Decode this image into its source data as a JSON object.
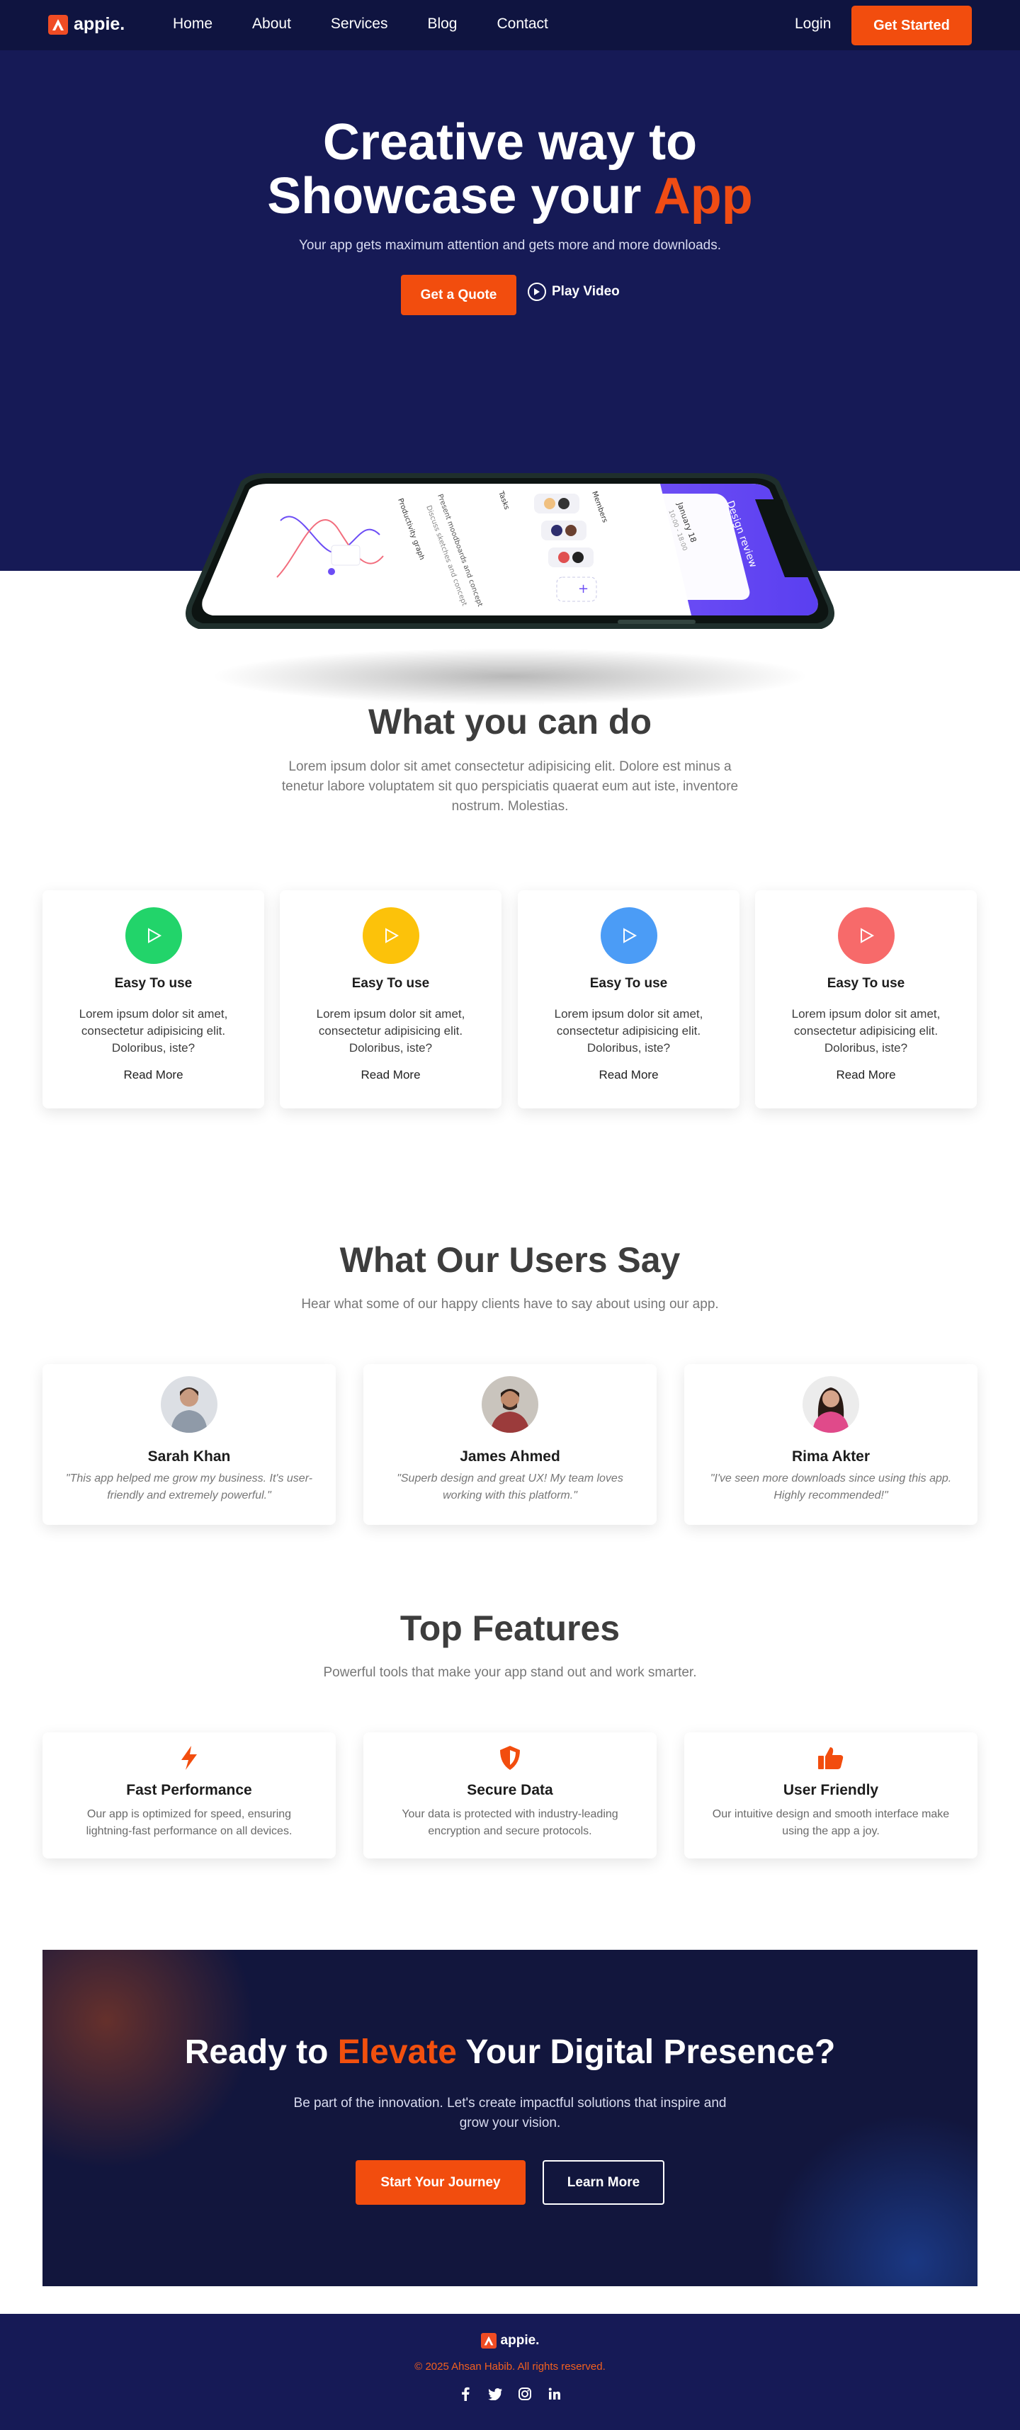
{
  "nav": {
    "brand": "appie.",
    "links": [
      "Home",
      "About",
      "Services",
      "Blog",
      "Contact"
    ],
    "login": "Login",
    "cta": "Get Started"
  },
  "hero": {
    "title_line1": "Creative way to",
    "title_line2_main": "Showcase your",
    "title_line2_accent": "App",
    "subtitle": "Your app gets maximum attention and gets more and more downloads.",
    "quote_button": "Get a Quote",
    "play_button": "Play Video"
  },
  "phone_screen": {
    "header": "Design review",
    "date": "January 18",
    "time": "10:00 - 18:00",
    "members_label": "Members",
    "tasks_label": "Tasks",
    "task1": "Present moodboards and concept",
    "task2": "Discuss sketches and concept",
    "graph_label": "Productivity graph"
  },
  "what": {
    "title": "What you can do",
    "subtitle": "Lorem ipsum dolor sit amet consectetur adipisicing elit. Dolore est minus a tenetur labore voluptatem sit quo perspiciatis quaerat eum aut iste, inventore nostrum. Molestias.",
    "cards": [
      {
        "title": "Easy To use",
        "text": "Lorem ipsum dolor sit amet, consectetur adipisicing elit. Doloribus, iste?",
        "link": "Read More",
        "color": "#22d46a"
      },
      {
        "title": "Easy To use",
        "text": "Lorem ipsum dolor sit amet, consectetur adipisicing elit. Doloribus, iste?",
        "link": "Read More",
        "color": "#fcc20a"
      },
      {
        "title": "Easy To use",
        "text": "Lorem ipsum dolor sit amet, consectetur adipisicing elit. Doloribus, iste?",
        "link": "Read More",
        "color": "#4b9cf6"
      },
      {
        "title": "Easy To use",
        "text": "Lorem ipsum dolor sit amet, consectetur adipisicing elit. Doloribus, iste?",
        "link": "Read More",
        "color": "#f76a6a"
      }
    ]
  },
  "users": {
    "title": "What Our Users Say",
    "subtitle": "Hear what some of our happy clients have to say about using our app.",
    "items": [
      {
        "name": "Sarah Khan",
        "quote": "\"This app helped me grow my business. It's user-friendly and extremely powerful.\""
      },
      {
        "name": "James Ahmed",
        "quote": "\"Superb design and great UX! My team loves working with this platform.\""
      },
      {
        "name": "Rima Akter",
        "quote": "\"I've seen more downloads since using this app. Highly recommended!\""
      }
    ]
  },
  "features": {
    "title": "Top Features",
    "subtitle": "Powerful tools that make your app stand out and work smarter.",
    "items": [
      {
        "icon": "bolt-icon",
        "title": "Fast Performance",
        "text": "Our app is optimized for speed, ensuring lightning-fast performance on all devices."
      },
      {
        "icon": "shield-icon",
        "title": "Secure Data",
        "text": "Your data is protected with industry-leading encryption and secure protocols."
      },
      {
        "icon": "thumbs-up-icon",
        "title": "User Friendly",
        "text": "Our intuitive design and smooth interface make using the app a joy."
      }
    ]
  },
  "cta": {
    "title_before": "Ready to",
    "title_accent": "Elevate",
    "title_after": "Your Digital Presence?",
    "subtitle": "Be part of the innovation. Let's create impactful solutions that inspire and grow your vision.",
    "primary": "Start Your Journey",
    "secondary": "Learn More"
  },
  "footer": {
    "brand": "appie.",
    "copyright": "© 2025 Ahsan Habib. All rights reserved.",
    "social": [
      "facebook-icon",
      "twitter-icon",
      "instagram-icon",
      "linkedin-icon"
    ]
  },
  "colors": {
    "navy": "#161a56",
    "nav_bg": "#0f1440",
    "accent": "#f24d0e"
  }
}
